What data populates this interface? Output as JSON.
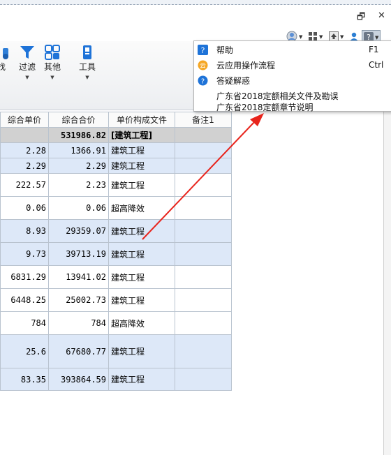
{
  "window": {
    "restore_glyph": "🗗",
    "close_glyph": "✕"
  },
  "ribbon": {
    "buttons": [
      {
        "label": "找",
        "icon": "binoculars-icon"
      },
      {
        "label": "过滤",
        "icon": "filter-icon"
      },
      {
        "label": "其他",
        "icon": "grid-icon"
      },
      {
        "label": "工具",
        "icon": "wrench-icon"
      }
    ],
    "dropdown_glyph": "▼"
  },
  "table": {
    "headers": [
      "综合单价",
      "综合合价",
      "单价构成文件",
      "备注1"
    ],
    "summary": {
      "total": "531986.82",
      "label": "[建筑工程]"
    },
    "rows": [
      {
        "unit_price": "2.28",
        "total_price": "1366.91",
        "file": "建筑工程",
        "style": "blue"
      },
      {
        "unit_price": "2.29",
        "total_price": "2.29",
        "file": "建筑工程",
        "style": "blue"
      },
      {
        "unit_price": "222.57",
        "total_price": "2.23",
        "file": "建筑工程",
        "style": "white"
      },
      {
        "unit_price": "0.06",
        "total_price": "0.06",
        "file": "超高降效",
        "style": "white"
      },
      {
        "unit_price": "8.93",
        "total_price": "29359.07",
        "file": "建筑工程",
        "style": "blue"
      },
      {
        "unit_price": "9.73",
        "total_price": "39713.19",
        "file": "建筑工程",
        "style": "blue"
      },
      {
        "unit_price": "6831.29",
        "total_price": "13941.02",
        "file": "建筑工程",
        "style": "white"
      },
      {
        "unit_price": "6448.25",
        "total_price": "25002.73",
        "file": "建筑工程",
        "style": "white"
      },
      {
        "unit_price": "784",
        "total_price": "784",
        "file": "超高降效",
        "style": "white"
      },
      {
        "unit_price": "25.6",
        "total_price": "67680.77",
        "file": "建筑工程",
        "style": "blue"
      },
      {
        "unit_price": "83.35",
        "total_price": "393864.59",
        "file": "建筑工程",
        "style": "blue"
      }
    ]
  },
  "help_menu": {
    "items": [
      {
        "label": "帮助",
        "shortcut": "F1",
        "icon": "help-icon"
      },
      {
        "label": "云应用操作流程",
        "shortcut": "Ctrl",
        "icon": "cloud-icon"
      },
      {
        "label": "答疑解惑",
        "shortcut": "",
        "icon": "question-bubble-icon"
      },
      {
        "label": "广东省2018定额相关文件及勘误",
        "shortcut": "",
        "icon": ""
      },
      {
        "label": "广东省2018定额章节说明",
        "shortcut": "",
        "icon": ""
      }
    ]
  },
  "annotation": {
    "arrow_color": "#e8241c"
  },
  "colors": {
    "row_blue": "#dde8f8",
    "summary_gray": "#d1d1d1",
    "accent_blue": "#1e73d8"
  }
}
